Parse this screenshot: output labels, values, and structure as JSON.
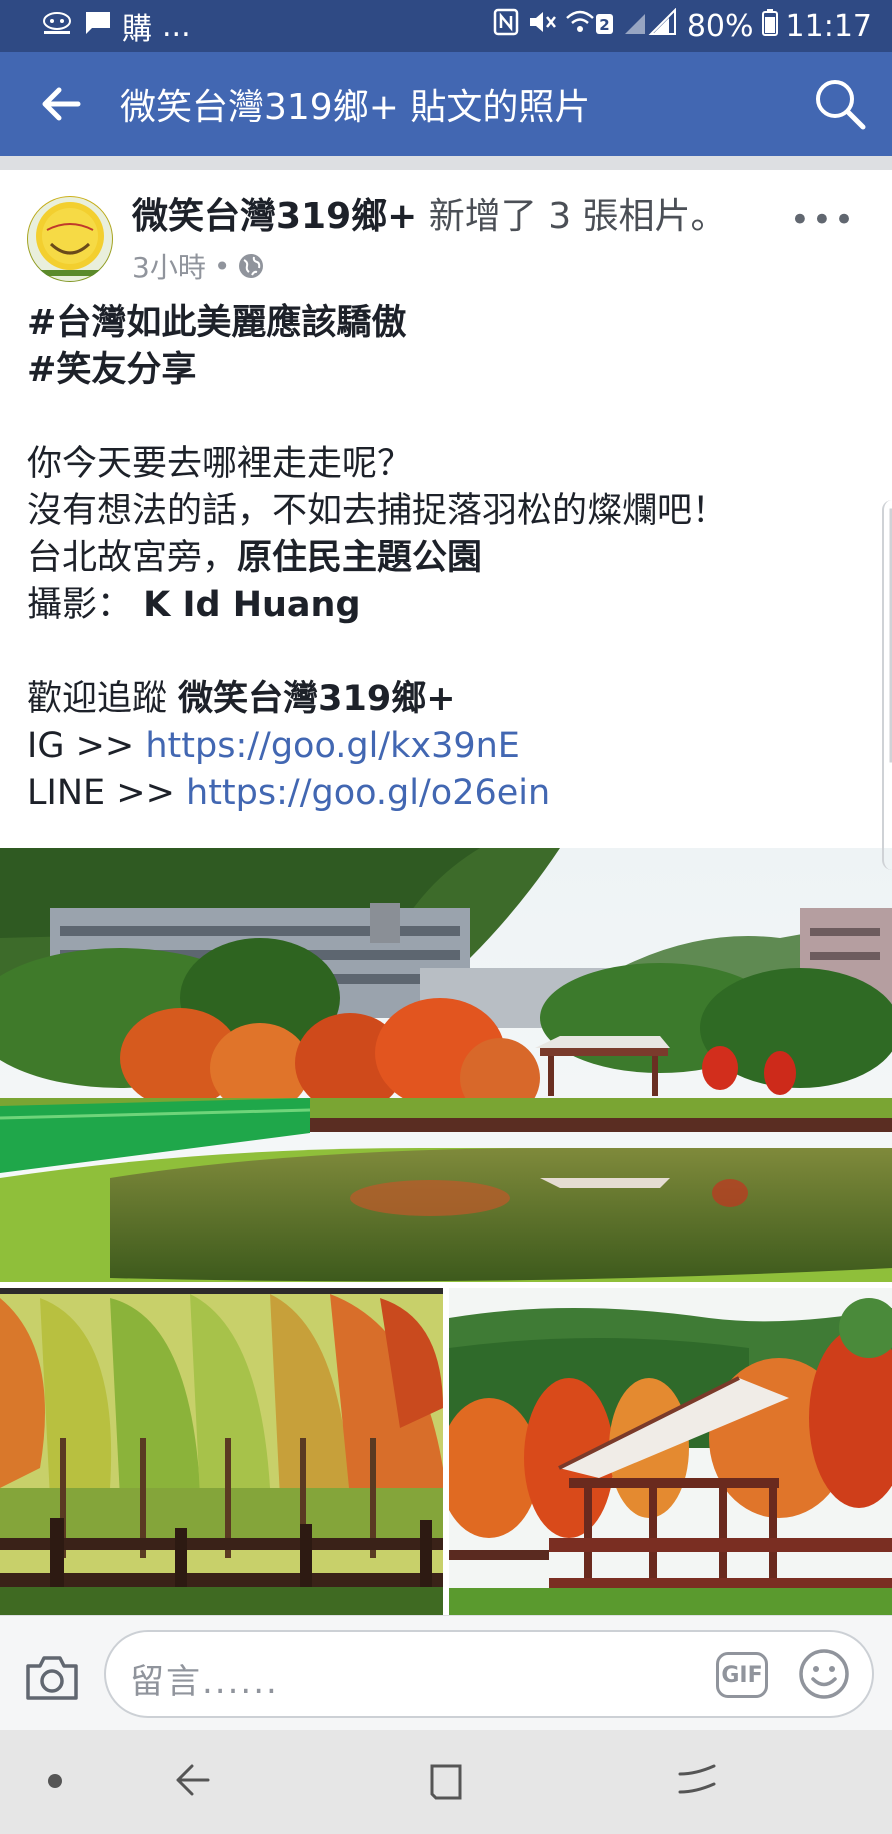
{
  "status_bar": {
    "left_text": "...",
    "battery": "80%",
    "time": "11:17",
    "wifi_badge": "2",
    "app_badge_label": "購"
  },
  "app_bar": {
    "title": "微笑台灣319鄉+ 貼文的照片",
    "back_icon": "arrow-left-icon",
    "search_icon": "search-icon",
    "background_color": "#4267b2",
    "status_color": "#2f4a84"
  },
  "post": {
    "author": "微笑台灣319鄉+",
    "action": " 新增了 3 張相片。",
    "time": "3小時",
    "dot": " • ",
    "privacy_icon": "globe-icon",
    "more_label": "•••",
    "lines": {
      "hashtag1": "#台灣如此美麗應該驕傲",
      "hashtag2": "#笑友分享",
      "q": "你今天要去哪裡走走呢？",
      "l2": "沒有想法的話，不如去捕捉落羽松的燦爛吧！",
      "l3_plain": "台北故宮旁，",
      "l3_bold": "原住民主題公園",
      "l4_plain": "攝影： ",
      "l4_bold": "K Id Huang",
      "l5_plain": "歡迎追蹤 ",
      "l5_bold": "微笑台灣319鄉+",
      "ig_label": "IG >> ",
      "ig_link": "https://goo.gl/kx39nE",
      "line_label": "LINE >> ",
      "line_link": "https://goo.gl/o26ein"
    },
    "link_color": "#4267b2",
    "photos": [
      "park-pond-photo",
      "cypress-trees-photo",
      "pavilion-photo"
    ]
  },
  "comment_bar": {
    "placeholder": "留言......",
    "gif_label": "GIF",
    "camera_icon": "camera-icon",
    "emoji_icon": "smiley-icon"
  },
  "nav_bar": {
    "icons": [
      "dot-icon",
      "back-nav-icon",
      "home-square-icon",
      "recent-apps-icon"
    ]
  }
}
